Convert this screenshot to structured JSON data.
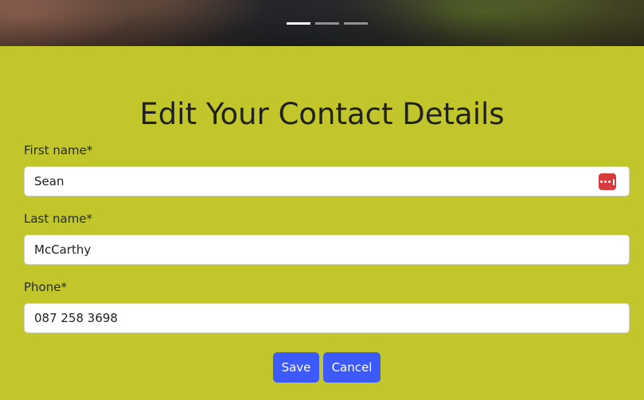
{
  "carousel": {
    "slide_count": 3,
    "active_index": 0
  },
  "page_title": "Edit Your Contact Details",
  "form": {
    "first_name": {
      "label": "First name*",
      "value": "Sean"
    },
    "last_name": {
      "label": "Last name*",
      "value": "McCarthy"
    },
    "phone": {
      "label": "Phone*",
      "value": "087 258 3698"
    }
  },
  "buttons": {
    "save_label": "Save",
    "cancel_label": "Cancel"
  },
  "colors": {
    "background": "#c1c62a",
    "button": "#3d5afe",
    "password_manager_icon": "#d63c3c"
  },
  "icons": {
    "password_manager": "password-manager-icon"
  }
}
